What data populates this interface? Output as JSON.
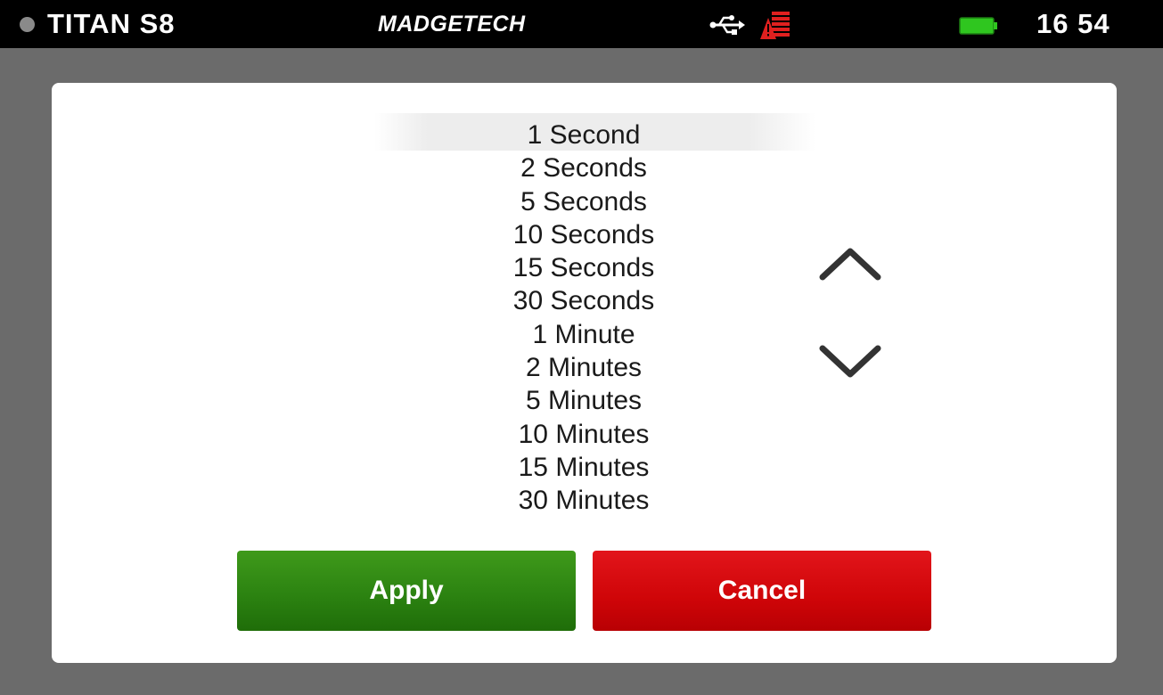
{
  "statusbar": {
    "device_name": "TITAN S8",
    "brand": "MADGETECH",
    "time": "16 54",
    "icons": [
      "status-dot-icon",
      "usb-icon",
      "alarm-icon",
      "battery-icon"
    ],
    "colors": {
      "background": "#000000",
      "alarm": "#e0201f",
      "battery": "#2fc61f"
    }
  },
  "dialog": {
    "options": [
      "1 Second",
      "2 Seconds",
      "5 Seconds",
      "10 Seconds",
      "15 Seconds",
      "30 Seconds",
      "1 Minute",
      "2 Minutes",
      "5 Minutes",
      "10 Minutes",
      "15 Minutes",
      "30 Minutes"
    ],
    "selected": "1 Second",
    "scroll_up_icon": "chevron-up-icon",
    "scroll_down_icon": "chevron-down-icon",
    "apply_label": "Apply",
    "cancel_label": "Cancel",
    "colors": {
      "apply": "#2c8311",
      "cancel": "#cf0508"
    }
  }
}
